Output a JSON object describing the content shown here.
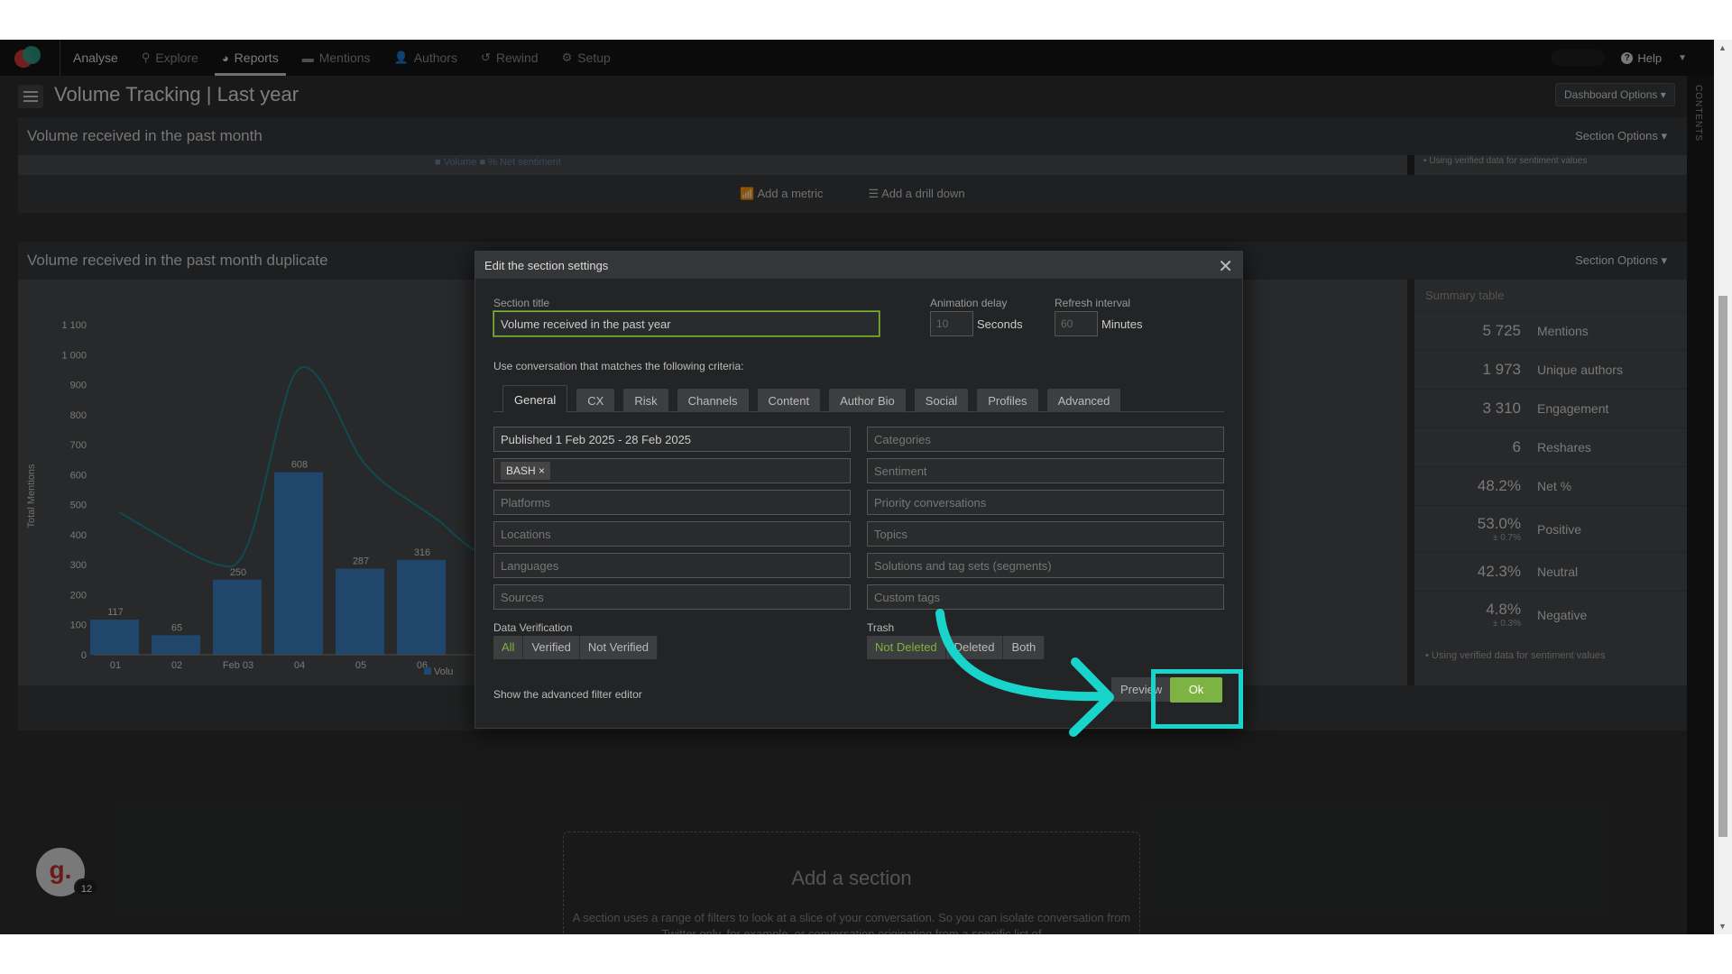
{
  "nav": {
    "brand": "Analyse",
    "items": [
      {
        "label": "Explore",
        "icon": "search-icon",
        "glyph": "⚲"
      },
      {
        "label": "Reports",
        "icon": "pie-icon",
        "glyph": "◕"
      },
      {
        "label": "Mentions",
        "icon": "comment-icon",
        "glyph": "▬"
      },
      {
        "label": "Authors",
        "icon": "user-icon",
        "glyph": "👤"
      },
      {
        "label": "Rewind",
        "icon": "history-icon",
        "glyph": "↺"
      },
      {
        "label": "Setup",
        "icon": "gear-icon",
        "glyph": "⚙"
      }
    ],
    "help": "Help"
  },
  "rstrip": "CONTENTS",
  "page_title": "Volume Tracking | Last year",
  "dashboard_options": "Dashboard Options ▾",
  "section1": {
    "title": "Volume received in the past month",
    "options": "Section Options ▾",
    "legend": "■ Volume  ■ % Net sentiment",
    "note": "• Using verified data for sentiment values",
    "add_metric": "Add a metric",
    "add_drilldown": "Add a drill down"
  },
  "section2": {
    "title": "Volume received in the past month duplicate",
    "options": "Section Options ▾"
  },
  "chart_data": {
    "type": "bar",
    "categories": [
      "01",
      "02",
      "Feb 03",
      "04",
      "05",
      "06"
    ],
    "series": [
      {
        "name": "Volume",
        "values": [
          117,
          65,
          250,
          608,
          287,
          316
        ]
      }
    ],
    "yticks": [
      "1 100",
      "1 000",
      "900",
      "800",
      "700",
      "600",
      "500",
      "400",
      "300",
      "200",
      "100",
      "0"
    ],
    "ylabel": "Total Mentions",
    "ylim": [
      0,
      1100
    ],
    "legend": "Volu",
    "colors": {
      "bar": "#3b82c4",
      "line": "#1a8a93"
    }
  },
  "summary": {
    "title": "Summary table",
    "rows": [
      {
        "value": "5 725",
        "sub": "",
        "label": "Mentions"
      },
      {
        "value": "1 973",
        "sub": "",
        "label": "Unique authors"
      },
      {
        "value": "3 310",
        "sub": "",
        "label": "Engagement"
      },
      {
        "value": "6",
        "sub": "",
        "label": "Reshares"
      },
      {
        "value": "48.2%",
        "sub": "",
        "label": "Net %"
      },
      {
        "value": "53.0%",
        "sub": "± 0.7%",
        "label": "Positive"
      },
      {
        "value": "42.3%",
        "sub": "",
        "label": "Neutral"
      },
      {
        "value": "4.8%",
        "sub": "± 0.3%",
        "label": "Negative"
      }
    ],
    "note": "Using verified data for sentiment values"
  },
  "modal": {
    "title": "Edit the section settings",
    "section_title_label": "Section title",
    "section_title_value": "Volume received in the past year",
    "animation_delay_label": "Animation delay",
    "animation_delay_placeholder": "10",
    "seconds": "Seconds",
    "refresh_interval_label": "Refresh interval",
    "refresh_interval_placeholder": "60",
    "minutes": "Minutes",
    "criteria": "Use conversation that matches the following criteria:",
    "tabs": [
      "General",
      "CX",
      "Risk",
      "Channels",
      "Content",
      "Author Bio",
      "Social",
      "Profiles",
      "Advanced"
    ],
    "left_fields": [
      "Published 1 Feb 2025 - 28 Feb 2025",
      "",
      "Platforms",
      "Locations",
      "Languages",
      "Sources"
    ],
    "chip": "BASH ×",
    "right_fields": [
      "Categories",
      "Sentiment",
      "Priority conversations",
      "Topics",
      "Solutions and tag sets (segments)",
      "Custom tags"
    ],
    "data_verification_label": "Data Verification",
    "verification": [
      "All",
      "Verified",
      "Not Verified"
    ],
    "trash_label": "Trash",
    "trash": [
      "Not Deleted",
      "Deleted",
      "Both"
    ],
    "advanced": "Show the advanced filter editor",
    "preview": "Preview",
    "ok": "Ok"
  },
  "add_section": {
    "title": "Add a section",
    "text": "A section uses a range of filters to look at a slice of your conversation. So you can isolate conversation from Twitter only, for example, or conversation originating from a specific list of"
  },
  "avatar": {
    "letter": "g.",
    "badge": "12"
  }
}
